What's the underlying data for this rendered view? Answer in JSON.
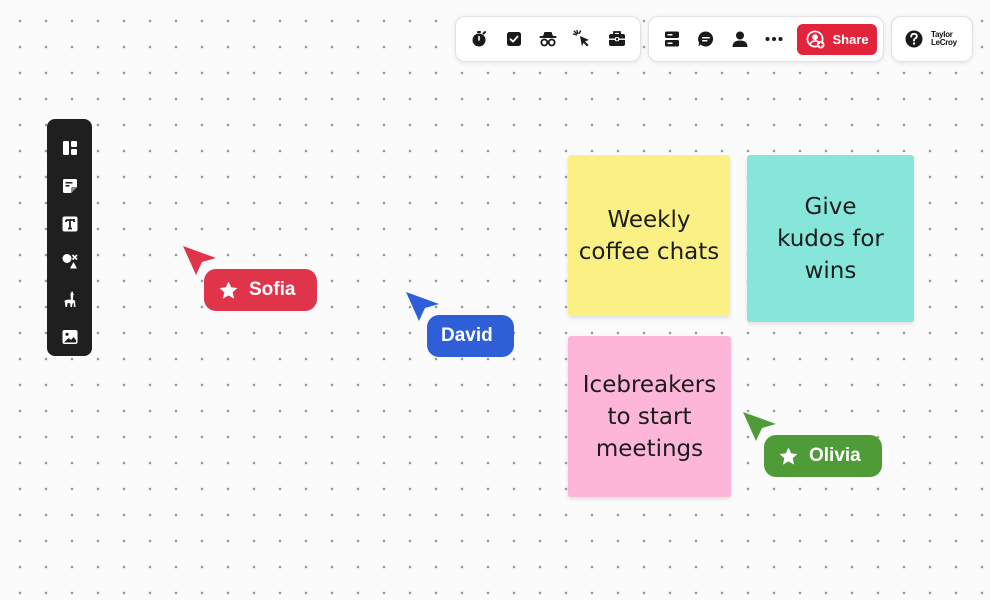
{
  "toolbar_left": {
    "items": [
      {
        "icon": "timer-icon"
      },
      {
        "icon": "checkbox-icon"
      },
      {
        "icon": "incognito-icon"
      },
      {
        "icon": "cursor-click-icon"
      },
      {
        "icon": "toolbox-icon"
      }
    ]
  },
  "toolbar_middle": {
    "items": [
      {
        "icon": "panels-icon"
      },
      {
        "icon": "comment-icon"
      },
      {
        "icon": "user-icon"
      },
      {
        "icon": "more-icon"
      }
    ],
    "share_label": "Share",
    "share_icon": "add-user-icon",
    "share_color": "#e1243b"
  },
  "toolbar_right": {
    "help_icon": "help-icon",
    "logo_line1": "Taylor",
    "logo_line2": "LeCroy"
  },
  "sidebar": {
    "items": [
      {
        "icon": "layout-icon"
      },
      {
        "icon": "sticky-note-icon"
      },
      {
        "icon": "text-icon"
      },
      {
        "icon": "shapes-icon"
      },
      {
        "icon": "llama-icon"
      },
      {
        "icon": "image-icon"
      }
    ]
  },
  "notes": [
    {
      "text": "Weekly coffee chats",
      "color": "#fbf083"
    },
    {
      "text": "Give kudos for wins",
      "color": "#86e6d9"
    },
    {
      "text": "Icebreakers to start meetings",
      "color": "#fdb6d8"
    }
  ],
  "cursors": [
    {
      "name": "Sofia",
      "color": "#e0344a",
      "star": true
    },
    {
      "name": "David",
      "color": "#2f5fd7",
      "star": false
    },
    {
      "name": "Olivia",
      "color": "#4f9b37",
      "star": true
    }
  ]
}
